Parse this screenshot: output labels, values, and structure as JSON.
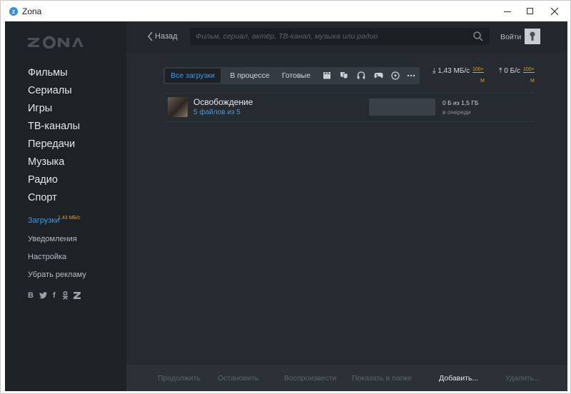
{
  "window": {
    "title": "Zona",
    "logo_letter": "z"
  },
  "sidebar": {
    "main_items": [
      {
        "label": "Фильмы"
      },
      {
        "label": "Сериалы"
      },
      {
        "label": "Игры"
      },
      {
        "label": "ТВ-каналы"
      },
      {
        "label": "Передачи"
      },
      {
        "label": "Музыка"
      },
      {
        "label": "Радио"
      },
      {
        "label": "Спорт"
      }
    ],
    "downloads": {
      "label": "Загрузки",
      "badge": "1,43 МБ/с"
    },
    "sub_items": [
      {
        "label": "Уведомления"
      },
      {
        "label": "Настройка"
      },
      {
        "label": "Убрать рекламу"
      }
    ],
    "social": [
      "В",
      "t",
      "f",
      "ok",
      "z"
    ]
  },
  "topbar": {
    "back_label": "Назад",
    "search_placeholder": "Фильм, сериал, актёр, ТВ-канал, музыка или радио",
    "login_label": "Войти"
  },
  "filters": {
    "tabs": [
      {
        "label": "Все загрузки",
        "active": true
      },
      {
        "label": "В процессе",
        "active": false
      },
      {
        "label": "Готовые",
        "active": false
      }
    ],
    "icons": [
      "clapperboard-icon",
      "theater-masks-icon",
      "headphones-icon",
      "gamepad-icon",
      "soccer-ball-icon",
      "more-icon"
    ]
  },
  "speeds": {
    "download": {
      "arrow": "⤓",
      "value": "1,43 МБ/с",
      "limit": "100+",
      "unit": "М"
    },
    "upload": {
      "arrow": "⤒",
      "value": "0 Б/с",
      "limit": "100+",
      "unit": "М"
    }
  },
  "downloads": [
    {
      "title": "Освобождение",
      "files": "5 файлов из 5",
      "progress": 0,
      "size": "0 Б из 1,5 ГБ",
      "status": "в очереди"
    }
  ],
  "actions": [
    {
      "label": "Продолжить",
      "enabled": false
    },
    {
      "label": "Остановить",
      "enabled": false
    },
    {
      "label": "Воспроизвести",
      "enabled": false
    },
    {
      "label": "Показать в папке",
      "enabled": false
    },
    {
      "label": "Добавить...",
      "enabled": true
    },
    {
      "label": "Удалить...",
      "enabled": false
    }
  ],
  "colors": {
    "accent": "#3d9be9",
    "limit": "#e6a21b",
    "sidebar_bg": "#1e2227",
    "main_bg": "#262b31"
  }
}
